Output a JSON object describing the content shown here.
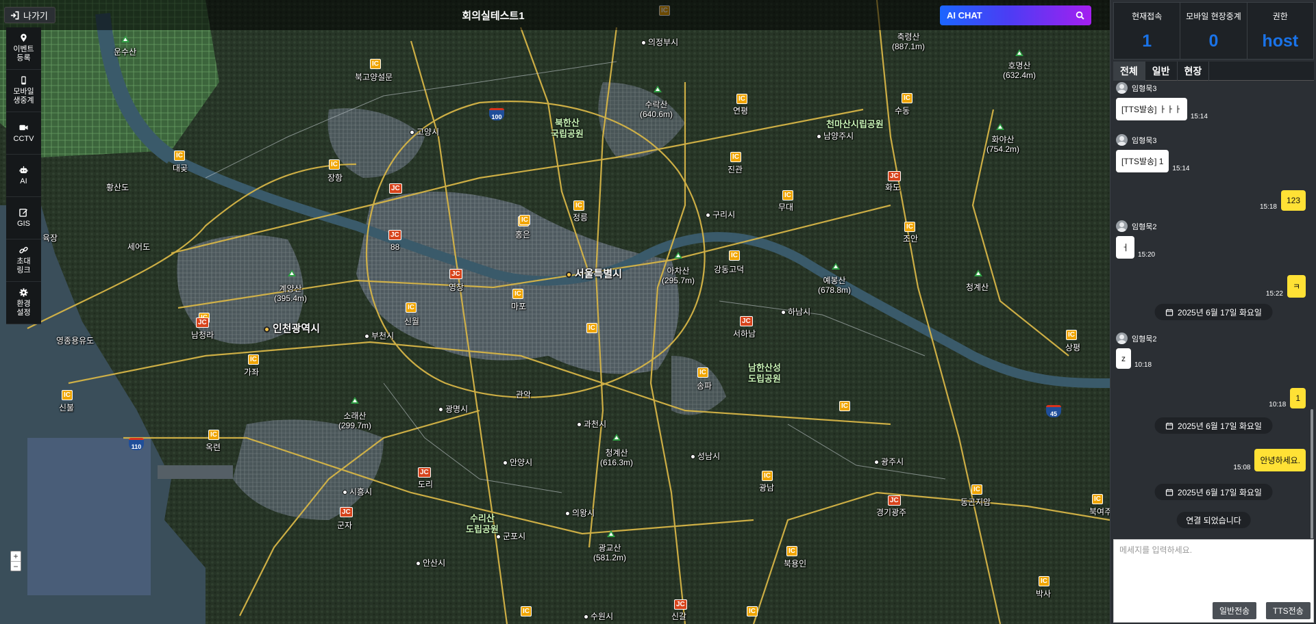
{
  "header": {
    "exit_label": "나가기",
    "title": "회의실테스트1",
    "ai_chat_label": "AI CHAT"
  },
  "tools": [
    {
      "label": "이벤트\n등록",
      "icon": "map-pin-icon"
    },
    {
      "label": "모바일\n생중계",
      "icon": "mobile-icon"
    },
    {
      "label": "CCTV",
      "icon": "video-camera-icon"
    },
    {
      "label": "AI",
      "icon": "robot-icon"
    },
    {
      "label": "GIS",
      "icon": "edit-icon"
    },
    {
      "label": "초대\n링크",
      "icon": "link-icon"
    },
    {
      "label": "환경\n설정",
      "icon": "gear-icon"
    }
  ],
  "zoom": {
    "in": "+",
    "out": "−"
  },
  "stats": {
    "current_label": "현재접속",
    "current_value": "1",
    "mobile_label": "모바일 현장중계",
    "mobile_value": "0",
    "role_label": "권한",
    "role_value": "host"
  },
  "tabs": [
    "전체",
    "일반",
    "현장"
  ],
  "chat": {
    "messages": [
      {
        "type": "other",
        "sender": "임형묵3",
        "text": "[TTS발송] ㅏㅏㅏ",
        "time": "15:14"
      },
      {
        "type": "other",
        "sender": "임형묵3",
        "text": "[TTS발송] 1",
        "time": "15:14"
      },
      {
        "type": "mine",
        "text": "123",
        "time": "15:18"
      },
      {
        "type": "other",
        "sender": "임형묵2",
        "text": "ㅓ",
        "time": "15:20"
      },
      {
        "type": "mine",
        "text": "ㅋ",
        "time": "15:22"
      },
      {
        "type": "date",
        "text": "2025년 6월 17일 화요일"
      },
      {
        "type": "other",
        "sender": "임형묵2",
        "text": "z",
        "time": "10:18"
      },
      {
        "type": "mine",
        "text": "1",
        "time": "10:18"
      },
      {
        "type": "date",
        "text": "2025년 6월 17일 화요일"
      },
      {
        "type": "mine",
        "text": "안녕하세요.",
        "time": "15:08"
      },
      {
        "type": "date",
        "text": "2025년 6월 17일 화요일"
      },
      {
        "type": "system",
        "text": "연결 되었습니다"
      }
    ],
    "placeholder": "메세지를 입력하세요.",
    "send_normal": "일반전송",
    "send_tts": "TTS전송"
  },
  "map": {
    "cities": [
      "서울특별시",
      "인천광역시"
    ],
    "places": [
      "의정부시",
      "고양시",
      "남양주시",
      "구리시",
      "하남시",
      "부천시",
      "광명시",
      "과천시",
      "성남시",
      "안양시",
      "시흥시",
      "의왕시",
      "군포시",
      "안산시",
      "광주시",
      "수원시",
      "북고양설문",
      "대곶",
      "장항",
      "황산도",
      "세어도",
      "육장",
      "영종용유도",
      "신불",
      "남청라",
      "가좌",
      "옥련",
      "신월",
      "영창",
      "마포",
      "홍은",
      "정릉",
      "연평",
      "수동",
      "진관",
      "무대",
      "조안",
      "화도",
      "강동고덕",
      "서하남",
      "송파",
      "관악",
      "동곤지암",
      "경기광주",
      "광남",
      "북용인",
      "신갈",
      "박사",
      "상평",
      "북여주",
      "88",
      "도리",
      "군자"
    ],
    "mountains": [
      "운수산",
      "수락산\n(640.6m)",
      "축령산\n(887.1m)",
      "호명산\n(632.4m)",
      "화야산\n(754.2m)",
      "아차산\n(295.7m)",
      "예봉산\n(678.8m)",
      "청계산",
      "계양산\n(395.4m)",
      "소래산\n(299.7m)",
      "청계산\n(616.3m)",
      "광교산\n(581.2m)"
    ],
    "parks": [
      "북한산\n국립공원",
      "천마산시립공원",
      "남한산성\n도립공원",
      "수리산\n도립공원"
    ],
    "highways": [
      "100",
      "110",
      "45"
    ],
    "colors": {
      "ic": "#f0a500",
      "jc": "#d8441c",
      "road": "#d6b547",
      "river": "#3a5a6a"
    }
  }
}
